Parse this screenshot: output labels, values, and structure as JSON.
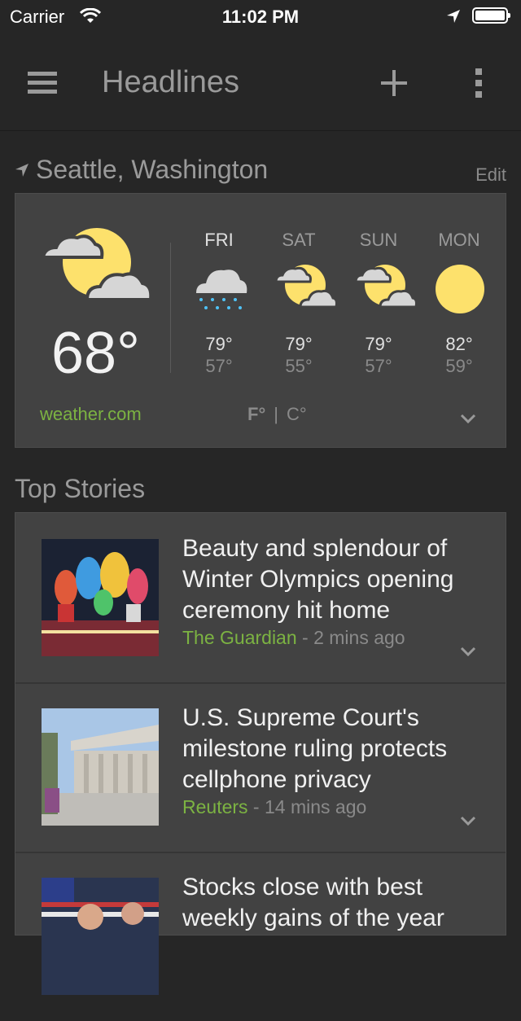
{
  "status_bar": {
    "carrier": "Carrier",
    "time": "11:02 PM",
    "wifi_icon": "wifi-icon",
    "location_icon": "location-arrow-icon",
    "battery_icon": "battery-icon"
  },
  "app_bar": {
    "title": "Headlines",
    "menu_icon": "hamburger-menu-icon",
    "add_icon": "plus-icon",
    "more_icon": "more-vertical-icon"
  },
  "location": {
    "name": "Seattle, Washington",
    "edit_label": "Edit",
    "icon": "navigation-arrow-icon"
  },
  "weather": {
    "current_temp": "68°",
    "current_icon": "partly-cloudy-icon",
    "source": "weather.com",
    "unit_f": "F°",
    "unit_separator": "|",
    "unit_c": "C°",
    "forecast": [
      {
        "day": "FRI",
        "icon": "rain-icon",
        "hi": "79°",
        "lo": "57°"
      },
      {
        "day": "SAT",
        "icon": "partly-cloudy-icon",
        "hi": "79°",
        "lo": "55°"
      },
      {
        "day": "SUN",
        "icon": "partly-cloudy-icon",
        "hi": "79°",
        "lo": "57°"
      },
      {
        "day": "MON",
        "icon": "sunny-icon",
        "hi": "82°",
        "lo": "59°"
      }
    ],
    "colors": {
      "sun": "#fde16c",
      "cloud": "#d6d6d6",
      "rain": "#4fc3f7"
    }
  },
  "top_stories": {
    "title": "Top Stories",
    "items": [
      {
        "headline": "Beauty and splendour of Winter Olympics opening ceremony hit home",
        "source": "The Guardian",
        "time": " - 2 mins ago"
      },
      {
        "headline": "U.S. Supreme Court's milestone ruling protects cellphone privacy",
        "source": "Reuters",
        "time": " - 14 mins ago"
      },
      {
        "headline": "Stocks close with best weekly gains of the year",
        "source": "",
        "time": ""
      }
    ]
  },
  "colors": {
    "background": "#262626",
    "card": "#424242",
    "accent": "#7cb342"
  }
}
